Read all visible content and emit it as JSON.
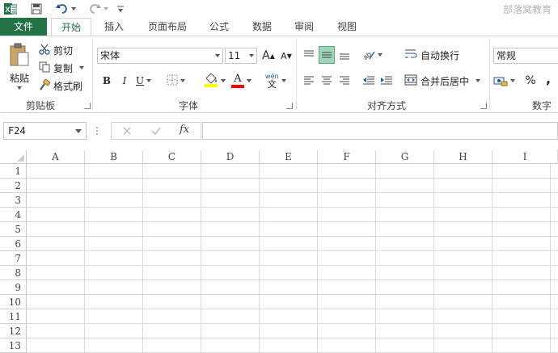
{
  "titlebar": {
    "excel_icon": "excel-icon",
    "save_icon": "save-icon",
    "undo_icon": "undo-icon",
    "redo_icon": "redo-icon",
    "customize_icon": "customize-qat-icon",
    "watermark": "部落窝教育"
  },
  "tabs": [
    {
      "label": "文件"
    },
    {
      "label": "开始"
    },
    {
      "label": "插入"
    },
    {
      "label": "页面布局"
    },
    {
      "label": "公式"
    },
    {
      "label": "数据"
    },
    {
      "label": "审阅"
    },
    {
      "label": "视图"
    }
  ],
  "ribbon": {
    "clipboard": {
      "paste": "粘贴",
      "cut": "剪切",
      "copy": "复制",
      "format_painter": "格式刷",
      "label": "剪贴板"
    },
    "font": {
      "font_name": "宋体",
      "font_size": "11",
      "bold": "B",
      "italic": "I",
      "underline": "U",
      "grow": "A",
      "shrink": "A",
      "font_color_letter": "A",
      "phonetic_top": "wén",
      "phonetic_bottom": "文",
      "label": "字体"
    },
    "alignment": {
      "wrap_text": "自动换行",
      "merge_center": "合并后居中",
      "label": "对齐方式"
    },
    "number": {
      "format": "常规",
      "percent": "%",
      "comma": ",",
      "label": "数字"
    }
  },
  "formula_bar": {
    "name_box": "F24",
    "fx": "fx",
    "formula": ""
  },
  "grid": {
    "columns": [
      "A",
      "B",
      "C",
      "D",
      "E",
      "F",
      "G",
      "H",
      "I"
    ],
    "rows": [
      "1",
      "2",
      "3",
      "4",
      "5",
      "6",
      "7",
      "8",
      "9",
      "10",
      "11",
      "12",
      "13"
    ]
  },
  "colors": {
    "accent": "#217346",
    "highlight_yellow": "#ffff00",
    "font_red": "#ff0000",
    "selected_align": "#9fd5b7"
  }
}
